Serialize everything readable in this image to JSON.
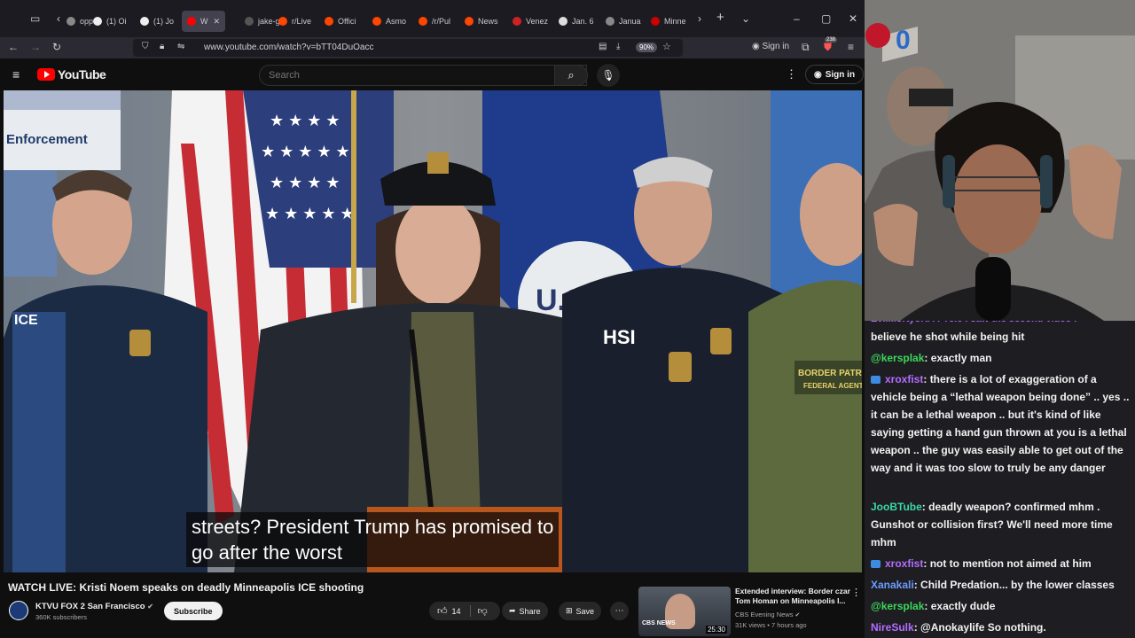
{
  "browser": {
    "tabs": [
      {
        "label": "opp",
        "fav": "#888"
      },
      {
        "label": "(1) Oi",
        "fav": "#eee"
      },
      {
        "label": "(1) Jo",
        "fav": "#eee"
      },
      {
        "label": "W",
        "fav": "#ff0000"
      },
      {
        "label": "jake-g",
        "fav": "#555"
      },
      {
        "label": "r/Live",
        "fav": "#ff4500"
      },
      {
        "label": "Offici",
        "fav": "#ff4500"
      },
      {
        "label": "Asmo",
        "fav": "#ff4500"
      },
      {
        "label": "/r/Pul",
        "fav": "#ff4500"
      },
      {
        "label": "News",
        "fav": "#ff4500"
      },
      {
        "label": "Venez",
        "fav": "#cc2222"
      },
      {
        "label": "Jan. 6",
        "fav": "#ddd"
      },
      {
        "label": "Janua",
        "fav": "#888"
      },
      {
        "label": "Minne",
        "fav": "#cc0000"
      }
    ],
    "url": "www.youtube.com/watch?v=bTT04DuOacc",
    "zoom": "90%",
    "signin_label": "Sign in",
    "extension_badge": "238"
  },
  "youtube": {
    "logo_text": "YouTube",
    "search_placeholder": "Search",
    "signin_label": "Sign in"
  },
  "video": {
    "caption_line1": "streets? President Trump has promised to",
    "caption_line2": "go after the worst",
    "title": "WATCH LIVE: Kristi Noem speaks on deadly Minneapolis ICE shooting",
    "channel_name": "KTVU FOX 2 San Francisco",
    "subscribers": "360K subscribers",
    "subscribe_label": "Subscribe",
    "likes": "14",
    "share_label": "Share",
    "save_label": "Save",
    "scene_text": {
      "enforcement": "Enforcement",
      "ice": "ICE",
      "hsi": "HSI",
      "border_patrol": "BORDER PATROL",
      "federal_agent": "FEDERAL AGENT",
      "seal": "U.S"
    }
  },
  "recommendation": {
    "title": "Extended interview: Border czar Tom Homan on Minneapolis I...",
    "channel": "CBS Evening News",
    "meta": "31K views • 7 hours ago",
    "duration": "25:30",
    "thumb_brand": "CBS NEWS"
  },
  "chat": {
    "messages": [
      {
        "user": "",
        "color": "#b56cff",
        "text": "believe he shot while being hit",
        "badge": false
      },
      {
        "user": "@kersplak",
        "color": "#3cd75b",
        "text": ": exactly man",
        "badge": false
      },
      {
        "user": "xroxfist",
        "color": "#b56cff",
        "text": ": there is a lot of exaggeration of a vehicle being a “lethal weapon being done” .. yes .. it can be a lethal weapon .. but it's kind of like saying getting a hand gun thrown at you is a lethal weapon .. the guy was easily able to get out of the way and it was too slow to truly be any danger",
        "badge": true
      },
      {
        "user": "JooBTube",
        "color": "#39d8a7",
        "text": ": deadly weapon? confirmed mhm . Gunshot or collision first? We'll need more time mhm",
        "badge": false
      },
      {
        "user": "xroxfist",
        "color": "#b56cff",
        "text": ": not to mention not aimed at him",
        "badge": true
      },
      {
        "user": "Xanakali",
        "color": "#6c9cff",
        "text": ": Child Predation... by the lower classes",
        "badge": false
      },
      {
        "user": "@kersplak",
        "color": "#3cd75b",
        "text": ": exactly dude",
        "badge": false
      },
      {
        "user": "NireSulk",
        "color": "#b56cff",
        "text": ": @Anokaylife So nothing.",
        "badge": false
      }
    ]
  },
  "colors": {
    "yt_red": "#ff0000",
    "chat_bg": "#1e1e22",
    "page_bg": "#0f0f0f"
  }
}
